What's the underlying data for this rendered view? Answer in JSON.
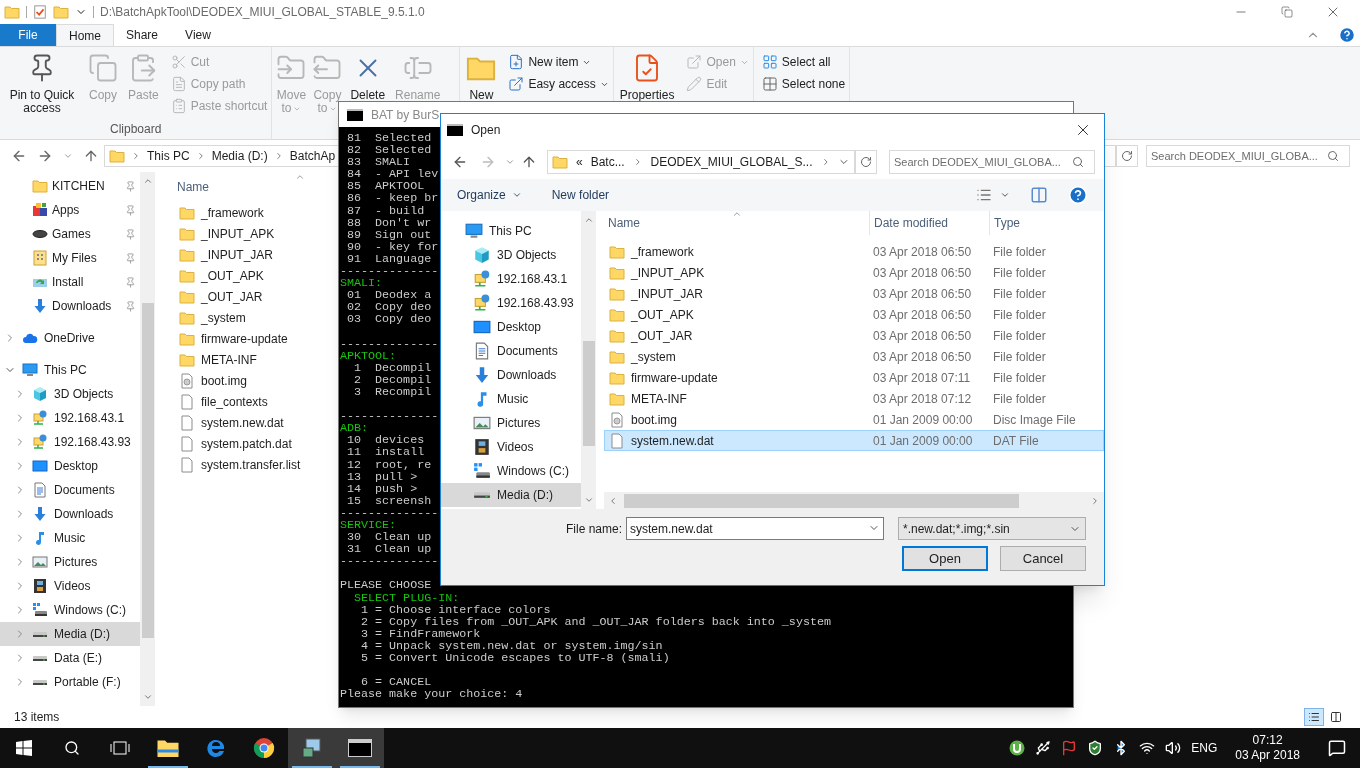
{
  "explorer": {
    "title": "D:\\BatchApkTool\\DEODEX_MIUI_GLOBAL_STABLE_9.5.1.0",
    "ribbon_tabs": [
      {
        "label": "File",
        "kind": "file-menu",
        "selected": false
      },
      {
        "label": "Home",
        "kind": "tab",
        "selected": true
      },
      {
        "label": "Share",
        "kind": "tab",
        "selected": false
      },
      {
        "label": "View",
        "kind": "tab",
        "selected": false
      }
    ],
    "ribbon_groups": [
      {
        "label": "Clipboard",
        "large": [
          {
            "label": "Pin to Quick access",
            "kind": "pin",
            "disabled": false,
            "dropdown": false
          },
          {
            "label": "Copy",
            "kind": "copy",
            "disabled": true,
            "dropdown": false
          },
          {
            "label": "Paste",
            "kind": "paste",
            "disabled": true,
            "dropdown": false
          }
        ],
        "small": [
          {
            "label": "Cut",
            "kind": "cut",
            "disabled": true,
            "dropdown": false
          },
          {
            "label": "Copy path",
            "kind": "copy-path",
            "disabled": true,
            "dropdown": false
          },
          {
            "label": "Paste shortcut",
            "kind": "paste-shortcut",
            "disabled": true,
            "dropdown": false
          }
        ]
      },
      {
        "large": [
          {
            "label": "Move to",
            "kind": "move",
            "disabled": true,
            "dropdown": true
          },
          {
            "label": "Copy to",
            "kind": "copy-to",
            "disabled": true,
            "dropdown": true
          },
          {
            "label": "Delete",
            "kind": "delete",
            "disabled": false,
            "dropdown": false
          },
          {
            "label": "Rename",
            "kind": "rename",
            "disabled": true,
            "dropdown": false
          }
        ]
      },
      {
        "large": [
          {
            "label": "New",
            "kind": "new-folder",
            "disabled": false,
            "dropdown": false
          }
        ],
        "small": [
          {
            "label": "New item",
            "kind": "new-item",
            "disabled": false,
            "dropdown": true
          },
          {
            "label": "Easy access",
            "kind": "easy-access",
            "disabled": false,
            "dropdown": true
          }
        ]
      },
      {
        "large": [
          {
            "label": "Properties",
            "kind": "properties",
            "disabled": false,
            "dropdown": false
          }
        ],
        "small": [
          {
            "label": "Open",
            "kind": "open",
            "disabled": true,
            "dropdown": true
          },
          {
            "label": "Edit",
            "kind": "edit",
            "disabled": true,
            "dropdown": false
          }
        ]
      },
      {
        "small": [
          {
            "label": "Select all",
            "kind": "select-all",
            "disabled": false,
            "dropdown": false
          },
          {
            "label": "Select none",
            "kind": "select-none",
            "disabled": false,
            "dropdown": false
          }
        ]
      }
    ],
    "address": [
      "This PC",
      "Media (D:)",
      "BatchAp"
    ],
    "search": {
      "placeholder": "Search DEODEX_MIUI_GLOBA..."
    },
    "quick_access": [
      {
        "label": "KITCHEN",
        "kind": "folder",
        "pinned": true
      },
      {
        "label": "Apps",
        "kind": "apps",
        "pinned": true
      },
      {
        "label": "Games",
        "kind": "games",
        "pinned": true
      },
      {
        "label": "My Files",
        "kind": "myfiles",
        "pinned": true
      },
      {
        "label": "Install",
        "kind": "install",
        "pinned": true
      },
      {
        "label": "Downloads",
        "kind": "downloads",
        "pinned": true
      }
    ],
    "tree": [
      {
        "label": "OneDrive",
        "kind": "cloud",
        "expanded": false,
        "selected": false
      },
      {
        "label": "This PC",
        "kind": "pc",
        "expanded": true,
        "selected": false,
        "children": [
          {
            "label": "3D Objects",
            "kind": "cube",
            "expanded": false,
            "selected": false
          },
          {
            "label": "192.168.43.1",
            "kind": "network",
            "expanded": false,
            "selected": false
          },
          {
            "label": "192.168.43.93",
            "kind": "network",
            "expanded": false,
            "selected": false
          },
          {
            "label": "Desktop",
            "kind": "desktop",
            "expanded": false,
            "selected": false
          },
          {
            "label": "Documents",
            "kind": "documents",
            "expanded": false,
            "selected": false
          },
          {
            "label": "Downloads",
            "kind": "downloads",
            "expanded": false,
            "selected": false
          },
          {
            "label": "Music",
            "kind": "music",
            "expanded": false,
            "selected": false
          },
          {
            "label": "Pictures",
            "kind": "pictures",
            "expanded": false,
            "selected": false
          },
          {
            "label": "Videos",
            "kind": "videos",
            "expanded": false,
            "selected": false
          },
          {
            "label": "Windows (C:)",
            "kind": "system-drive",
            "expanded": false,
            "selected": false
          },
          {
            "label": "Media (D:)",
            "kind": "drive",
            "expanded": false,
            "selected": true
          },
          {
            "label": "Data (E:)",
            "kind": "drive",
            "expanded": false,
            "selected": false
          },
          {
            "label": "Portable (F:)",
            "kind": "drive",
            "expanded": false,
            "selected": false
          }
        ]
      }
    ],
    "column": "Name",
    "files": [
      {
        "name": "_framework",
        "kind": "folder"
      },
      {
        "name": "_INPUT_APK",
        "kind": "folder"
      },
      {
        "name": "_INPUT_JAR",
        "kind": "folder"
      },
      {
        "name": "_OUT_APK",
        "kind": "folder"
      },
      {
        "name": "_OUT_JAR",
        "kind": "folder"
      },
      {
        "name": "_system",
        "kind": "folder"
      },
      {
        "name": "firmware-update",
        "kind": "folder"
      },
      {
        "name": "META-INF",
        "kind": "folder"
      },
      {
        "name": "boot.img",
        "kind": "disc"
      },
      {
        "name": "file_contexts",
        "kind": "file"
      },
      {
        "name": "system.new.dat",
        "kind": "file"
      },
      {
        "name": "system.patch.dat",
        "kind": "file"
      },
      {
        "name": "system.transfer.list",
        "kind": "file"
      }
    ],
    "status": "13 items"
  },
  "console": {
    "title": "BAT by BurS",
    "lines": [
      {
        "kind": "line",
        "text": " 81  Selected"
      },
      {
        "kind": "line",
        "text": " 82  Selected"
      },
      {
        "kind": "line",
        "text": " 83  SMALI"
      },
      {
        "kind": "line",
        "text": " 84  - API lev"
      },
      {
        "kind": "line",
        "text": " 85  APKTOOL"
      },
      {
        "kind": "line",
        "text": " 86  - keep br"
      },
      {
        "kind": "line",
        "text": " 87  - build"
      },
      {
        "kind": "line",
        "text": " 88  Don't wr"
      },
      {
        "kind": "line",
        "text": " 89  Sign out"
      },
      {
        "kind": "line",
        "text": " 90  - key for"
      },
      {
        "kind": "line",
        "text": " 91  Language"
      },
      {
        "kind": "line",
        "text": "--------------"
      },
      {
        "kind": "heading",
        "text": "SMALI:"
      },
      {
        "kind": "line",
        "text": " 01  Deodex a"
      },
      {
        "kind": "line",
        "text": " 02  Copy deo"
      },
      {
        "kind": "line",
        "text": " 03  Copy deo"
      },
      {
        "kind": "blank"
      },
      {
        "kind": "line",
        "text": "--------------"
      },
      {
        "kind": "heading",
        "text": "APKTOOL:"
      },
      {
        "kind": "line",
        "text": "  1  Decompil"
      },
      {
        "kind": "line",
        "text": "  2  Decompil"
      },
      {
        "kind": "line",
        "text": "  3  Recompil"
      },
      {
        "kind": "blank"
      },
      {
        "kind": "line",
        "text": "--------------"
      },
      {
        "kind": "heading",
        "text": "ADB:"
      },
      {
        "kind": "line",
        "text": " 10  devices"
      },
      {
        "kind": "line",
        "text": " 11  install"
      },
      {
        "kind": "line",
        "text": " 12  root, re"
      },
      {
        "kind": "line",
        "text": " 13  pull >"
      },
      {
        "kind": "line",
        "text": " 14  push >"
      },
      {
        "kind": "line",
        "text": " 15  screensh"
      },
      {
        "kind": "line",
        "text": "--------------"
      },
      {
        "kind": "heading",
        "text": "SERVICE:"
      },
      {
        "kind": "line",
        "text": " 30  Clean up"
      },
      {
        "kind": "line",
        "text": " 31  Clean up"
      },
      {
        "kind": "line",
        "text": "--------------"
      },
      {
        "kind": "blank"
      },
      {
        "kind": "line",
        "text": "PLEASE CHOOSE"
      },
      {
        "kind": "heading",
        "text": "  SELECT PLUG-IN:"
      },
      {
        "kind": "line",
        "text": "   1 = Choose interface colors"
      },
      {
        "kind": "line",
        "text": "   2 = Copy files from _OUT_APK and _OUT_JAR folders back into _system"
      },
      {
        "kind": "line",
        "text": "   3 = FindFramework"
      },
      {
        "kind": "line",
        "text": "   4 = Unpack system.new.dat or system.img/sin"
      },
      {
        "kind": "line",
        "text": "   5 = Convert Unicode escapes to UTF-8 (smali)"
      },
      {
        "kind": "blank"
      },
      {
        "kind": "line",
        "text": "   6 = CANCEL"
      },
      {
        "kind": "line",
        "text": "Please make your choice: 4"
      }
    ]
  },
  "dialog": {
    "title": "Open",
    "breadcrumb": {
      "overflow": "«",
      "parts": [
        "Batc...",
        "DEODEX_MIUI_GLOBAL_S..."
      ]
    },
    "search": {
      "placeholder": "Search DEODEX_MIUI_GLOBA..."
    },
    "toolbar": [
      "Organize",
      "New folder"
    ],
    "nav": [
      {
        "label": "This PC",
        "kind": "pc",
        "selected": false,
        "children": [
          {
            "label": "3D Objects",
            "kind": "cube",
            "selected": false
          },
          {
            "label": "192.168.43.1",
            "kind": "network",
            "selected": false
          },
          {
            "label": "192.168.43.93",
            "kind": "network",
            "selected": false
          },
          {
            "label": "Desktop",
            "kind": "desktop",
            "selected": false
          },
          {
            "label": "Documents",
            "kind": "documents",
            "selected": false
          },
          {
            "label": "Downloads",
            "kind": "downloads",
            "selected": false
          },
          {
            "label": "Music",
            "kind": "music",
            "selected": false
          },
          {
            "label": "Pictures",
            "kind": "pictures",
            "selected": false
          },
          {
            "label": "Videos",
            "kind": "videos",
            "selected": false
          },
          {
            "label": "Windows (C:)",
            "kind": "system-drive",
            "selected": false
          },
          {
            "label": "Media (D:)",
            "kind": "drive",
            "selected": true
          }
        ]
      }
    ],
    "columns": [
      "Name",
      "Date modified",
      "Type"
    ],
    "rows": [
      {
        "name": "_framework",
        "kind": "folder",
        "date": "03 Apr 2018 06:50",
        "type": "File folder",
        "selected": false
      },
      {
        "name": "_INPUT_APK",
        "kind": "folder",
        "date": "03 Apr 2018 06:50",
        "type": "File folder",
        "selected": false
      },
      {
        "name": "_INPUT_JAR",
        "kind": "folder",
        "date": "03 Apr 2018 06:50",
        "type": "File folder",
        "selected": false
      },
      {
        "name": "_OUT_APK",
        "kind": "folder",
        "date": "03 Apr 2018 06:50",
        "type": "File folder",
        "selected": false
      },
      {
        "name": "_OUT_JAR",
        "kind": "folder",
        "date": "03 Apr 2018 06:50",
        "type": "File folder",
        "selected": false
      },
      {
        "name": "_system",
        "kind": "folder",
        "date": "03 Apr 2018 06:50",
        "type": "File folder",
        "selected": false
      },
      {
        "name": "firmware-update",
        "kind": "folder",
        "date": "03 Apr 2018 07:11",
        "type": "File folder",
        "selected": false
      },
      {
        "name": "META-INF",
        "kind": "folder",
        "date": "03 Apr 2018 07:12",
        "type": "File folder",
        "selected": false
      },
      {
        "name": "boot.img",
        "kind": "disc",
        "date": "01 Jan 2009 00:00",
        "type": "Disc Image File",
        "selected": false
      },
      {
        "name": "system.new.dat",
        "kind": "file",
        "date": "01 Jan 2009 00:00",
        "type": "DAT File",
        "selected": true
      }
    ],
    "file_name_label": "File name:",
    "file_name": "system.new.dat",
    "filter": "*.new.dat;*.img;*.sin",
    "buttons": [
      {
        "label": "Open",
        "kind": "default"
      },
      {
        "label": "Cancel",
        "kind": "normal"
      }
    ]
  },
  "taskbar": {
    "apps": [
      {
        "kind": "explorer",
        "running": true,
        "active": false
      },
      {
        "kind": "edge",
        "running": false,
        "active": false
      },
      {
        "kind": "chrome",
        "running": false,
        "active": false
      },
      {
        "kind": "batch",
        "running": true,
        "active": true
      },
      {
        "kind": "console",
        "running": true,
        "active": true
      }
    ],
    "language": "ENG",
    "time": "07:12",
    "date": "03 Apr 2018"
  }
}
